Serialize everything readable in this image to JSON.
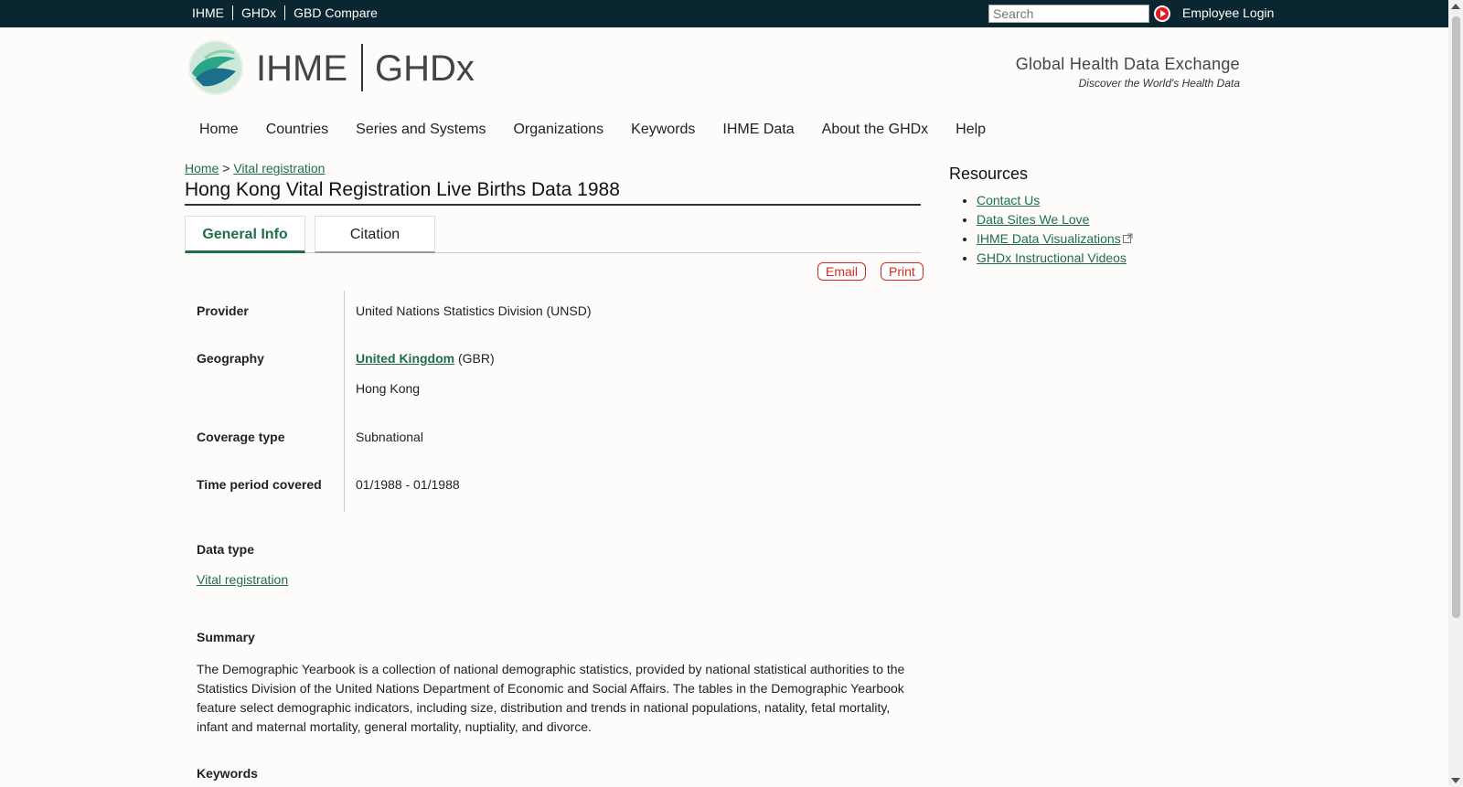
{
  "topbar": {
    "links": [
      "IHME",
      "GHDx",
      "GBD Compare"
    ],
    "search_placeholder": "Search",
    "login": "Employee Login"
  },
  "header": {
    "logo_left": "IHME",
    "logo_right": "GHDx",
    "brand_title": "Global Health Data Exchange",
    "brand_subtitle": "Discover the World's Health Data"
  },
  "nav": [
    "Home",
    "Countries",
    "Series and Systems",
    "Organizations",
    "Keywords",
    "IHME Data",
    "About the GHDx",
    "Help"
  ],
  "breadcrumb": {
    "home": "Home",
    "sep": ">",
    "current": "Vital registration"
  },
  "page_title": "Hong Kong Vital Registration Live Births Data 1988",
  "tabs": {
    "general": "General Info",
    "citation": "Citation"
  },
  "actions": {
    "email": "Email",
    "print": "Print"
  },
  "fields": {
    "provider_label": "Provider",
    "provider_value": "United Nations Statistics Division (UNSD)",
    "geography_label": "Geography",
    "geography_country": "United Kingdom",
    "geography_code": "(GBR)",
    "geography_sub": "Hong Kong",
    "coverage_label": "Coverage type",
    "coverage_value": "Subnational",
    "time_label": "Time period covered",
    "time_value": "01/1988 - 01/1988"
  },
  "data_type": {
    "label": "Data type",
    "value": "Vital registration"
  },
  "summary": {
    "label": "Summary",
    "text": "The Demographic Yearbook is a collection of national demographic statistics, provided by national statistical authorities to the Statistics Division of the United Nations Department of Economic and Social Affairs. The tables in the Demographic Yearbook feature select demographic indicators, including size, distribution and trends in national populations, natality, fetal mortality, infant and maternal mortality, general mortality, nuptiality, and divorce."
  },
  "keywords_label": "Keywords",
  "resources": {
    "heading": "Resources",
    "items": [
      "Contact Us",
      "Data Sites We Love",
      "IHME Data Visualizations",
      "GHDx Instructional Videos"
    ]
  },
  "colors": {
    "topbar": "#0a2630",
    "link": "#1d7046",
    "action_red": "#d52a1e"
  }
}
